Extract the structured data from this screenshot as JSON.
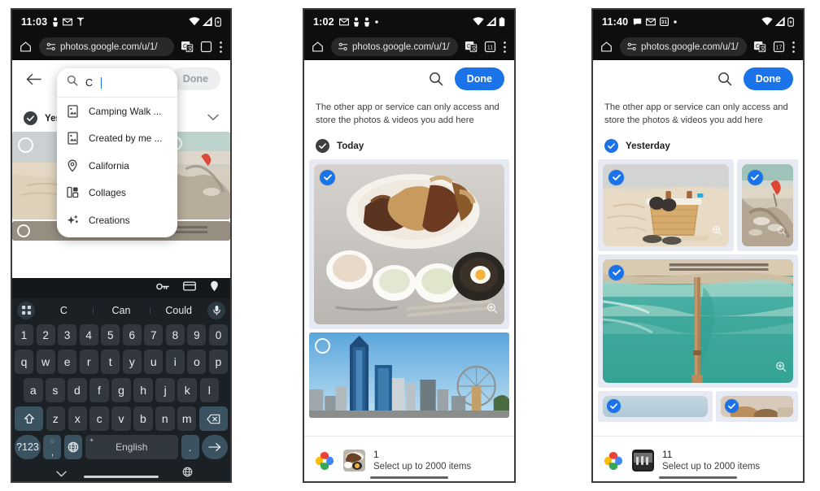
{
  "panels": [
    {
      "id": "panel-1",
      "status": {
        "time": "11:03",
        "icons_left": [
          "person-icon",
          "mail-icon",
          "antenna-icon"
        ],
        "icons_right": [
          "wifi-icon",
          "signal-icon",
          "battery-icon"
        ]
      },
      "chrome": {
        "home_icon": "home-icon",
        "url": "photos.google.com/u/1/",
        "lock_icon": "tune-lock-icon",
        "translate_icon": "translate-icon",
        "tabs_icon": "tabs-icon",
        "tabs_count": "",
        "menu_icon": "overflow-menu-icon"
      },
      "apptop": {
        "back_icon": "back-arrow-icon",
        "done_label": "Done",
        "done_enabled": false
      },
      "search": {
        "icon": "search-icon",
        "query": "C",
        "suggestions": [
          {
            "icon": "photo-album-icon",
            "label": "Camping Walk ..."
          },
          {
            "icon": "photo-album-icon",
            "label": "Created by me ..."
          },
          {
            "icon": "location-pin-icon",
            "label": "California"
          },
          {
            "icon": "collage-icon",
            "label": "Collages"
          },
          {
            "icon": "sparkle-icon",
            "label": "Creations"
          }
        ]
      },
      "section": {
        "label": "Yeste",
        "checked": true,
        "chevron": "chevron-down-icon"
      },
      "keyboard": {
        "toolbar_icons": [
          "password-key-icon",
          "card-icon",
          "location-pin-icon"
        ],
        "suggestions": [
          "C",
          "Can",
          "Could"
        ],
        "grid_icon": "app-grid-icon",
        "mic_icon": "microphone-icon",
        "numbers": [
          "1",
          "2",
          "3",
          "4",
          "5",
          "6",
          "7",
          "8",
          "9",
          "0"
        ],
        "row1": [
          "q",
          "w",
          "e",
          "r",
          "t",
          "y",
          "u",
          "i",
          "o",
          "p"
        ],
        "row2": [
          "a",
          "s",
          "d",
          "f",
          "g",
          "h",
          "j",
          "k",
          "l"
        ],
        "row3": [
          "z",
          "x",
          "c",
          "v",
          "b",
          "n",
          "m"
        ],
        "shift_icon": "shift-icon",
        "backspace_icon": "backspace-icon",
        "sym_key": "?123",
        "comma_key": ",",
        "comma_sup": "☺",
        "globe_icon": "globe-icon",
        "space_label": "English",
        "space_sup": "spark-icon",
        "period_key": ".",
        "enter_icon": "enter-arrow-icon",
        "nav_down_icon": "chevron-down-icon",
        "nav_globe_icon": "globe-icon"
      }
    },
    {
      "id": "panel-2",
      "status": {
        "time": "1:02",
        "icons_left": [
          "mail-icon",
          "person-icon",
          "person-icon",
          "dot-icon"
        ],
        "icons_right": [
          "wifi-icon",
          "signal-icon",
          "battery-icon"
        ]
      },
      "chrome": {
        "home_icon": "home-icon",
        "url": "photos.google.com/u/1/",
        "translate_icon": "translate-icon",
        "tabs_icon": "tabs-icon",
        "tabs_count": "11",
        "menu_icon": "overflow-menu-icon"
      },
      "apptop": {
        "search_icon": "search-icon",
        "done_label": "Done",
        "done_enabled": true
      },
      "notice": "The other app or service can only access and store the photos & videos you add here",
      "section": {
        "label": "Today",
        "checked": true
      },
      "photos": [
        {
          "name": "korean-food-platter",
          "selected": true,
          "zoom_icon": "zoom-in-icon"
        },
        {
          "name": "city-skyline-ferris-wheel",
          "selected": false
        }
      ],
      "appbar": {
        "count": "1",
        "hint": "Select up to 2000 items",
        "logo": "google-photos-logo",
        "thumb": "korean-food-thumb"
      }
    },
    {
      "id": "panel-3",
      "status": {
        "time": "11:40",
        "icons_left": [
          "chat-icon",
          "mail-icon",
          "calendar-icon",
          "dot-icon"
        ],
        "icons_right": [
          "wifi-icon",
          "signal-icon",
          "battery-icon"
        ]
      },
      "chrome": {
        "home_icon": "home-icon",
        "url": "photos.google.com/u/1/",
        "translate_icon": "translate-icon",
        "tabs_icon": "tabs-icon",
        "tabs_count": "17",
        "menu_icon": "overflow-menu-icon"
      },
      "apptop": {
        "search_icon": "search-icon",
        "done_label": "Done",
        "done_enabled": true
      },
      "notice": "The other app or service can only access and store the photos & videos you add here",
      "section": {
        "label": "Yesterday",
        "checked": true
      },
      "photos": [
        {
          "name": "beach-basket-sunglasses",
          "selected": true,
          "zoom_icon": "zoom-in-icon"
        },
        {
          "name": "beach-rocks-red-flag",
          "selected": true,
          "zoom_icon": "zoom-in-icon"
        },
        {
          "name": "aerial-turquoise-pier",
          "selected": true,
          "zoom_icon": "zoom-in-icon"
        },
        {
          "name": "partial-photo-left",
          "selected": true
        },
        {
          "name": "partial-photo-right",
          "selected": true
        }
      ],
      "appbar": {
        "count": "11",
        "hint": "Select up to 2000 items",
        "logo": "google-photos-logo",
        "thumb": "bw-group-thumb"
      }
    }
  ],
  "colors": {
    "accent_blue": "#1a73e8",
    "status_bg": "#0e0e0e",
    "grid_bg": "#e8eaf3",
    "keyboard_bg": "#1b2024",
    "key_bg": "#32393e",
    "key_accent": "#3b5360"
  }
}
